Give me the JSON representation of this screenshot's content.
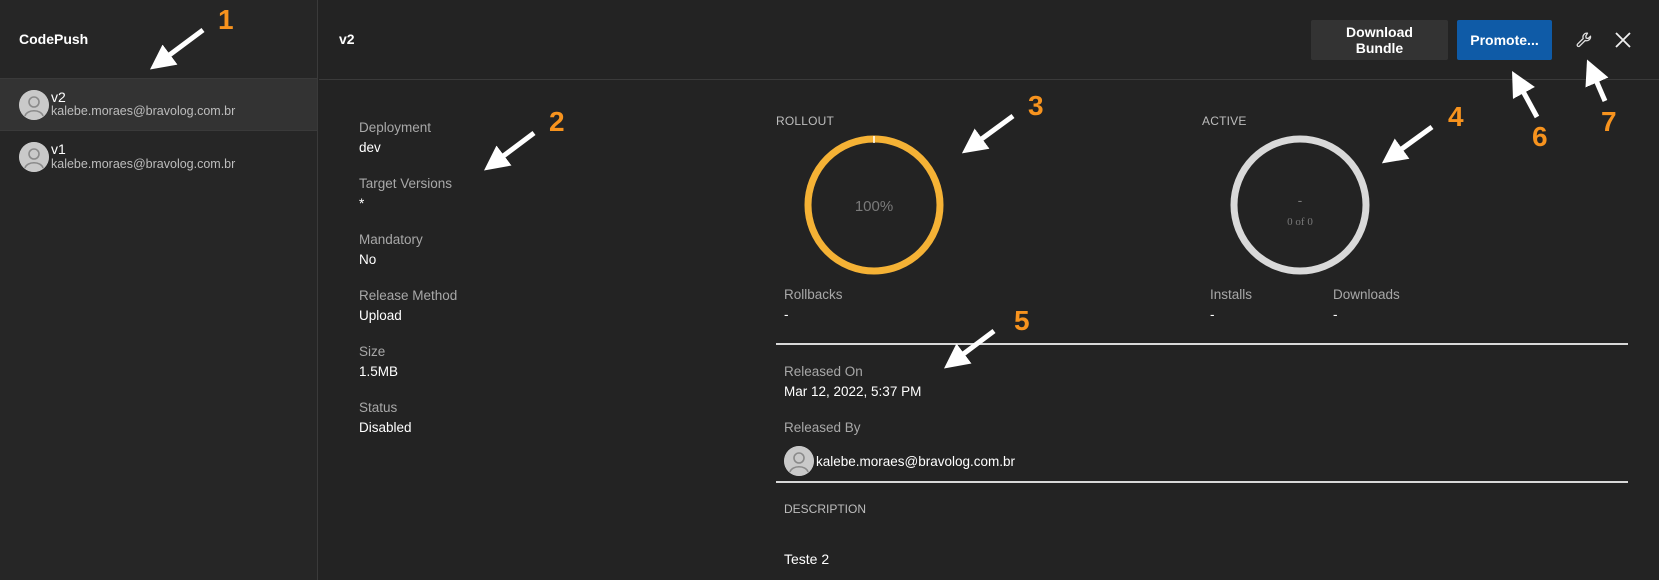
{
  "sidebar": {
    "title": "CodePush",
    "releases": [
      {
        "name": "v2",
        "email": "kalebe.moraes@bravolog.com.br",
        "selected": true
      },
      {
        "name": "v1",
        "email": "kalebe.moraes@bravolog.com.br",
        "selected": false
      }
    ]
  },
  "header": {
    "title": "v2",
    "download_label": "Download Bundle",
    "promote_label": "Promote...",
    "icons": {
      "settings": "wrench-icon",
      "close": "close-icon"
    }
  },
  "details": {
    "deployment_label": "Deployment",
    "deployment_value": "dev",
    "target_label": "Target Versions",
    "target_value": "*",
    "mandatory_label": "Mandatory",
    "mandatory_value": "No",
    "method_label": "Release Method",
    "method_value": "Upload",
    "size_label": "Size",
    "size_value": "1.5MB",
    "status_label": "Status",
    "status_value": "Disabled"
  },
  "rollout": {
    "caption": "ROLLOUT",
    "percent_text": "100%",
    "percent": 100,
    "color": "#f5b235",
    "rollbacks_label": "Rollbacks",
    "rollbacks_value": "-"
  },
  "active": {
    "caption": "ACTIVE",
    "value": "-",
    "sub": "0 of 0",
    "color": "#d9d9d9",
    "installs_label": "Installs",
    "installs_value": "-",
    "downloads_label": "Downloads",
    "downloads_value": "-"
  },
  "release_info": {
    "released_on_label": "Released On",
    "released_on_value": "Mar 12, 2022, 5:37 PM",
    "released_by_label": "Released By",
    "released_by_value": "kalebe.moraes@bravolog.com.br"
  },
  "description": {
    "caption": "DESCRIPTION",
    "text": "Teste 2"
  },
  "annotations": {
    "color": "#f7931e",
    "numbers": [
      "1",
      "2",
      "3",
      "4",
      "5",
      "6",
      "7"
    ]
  }
}
